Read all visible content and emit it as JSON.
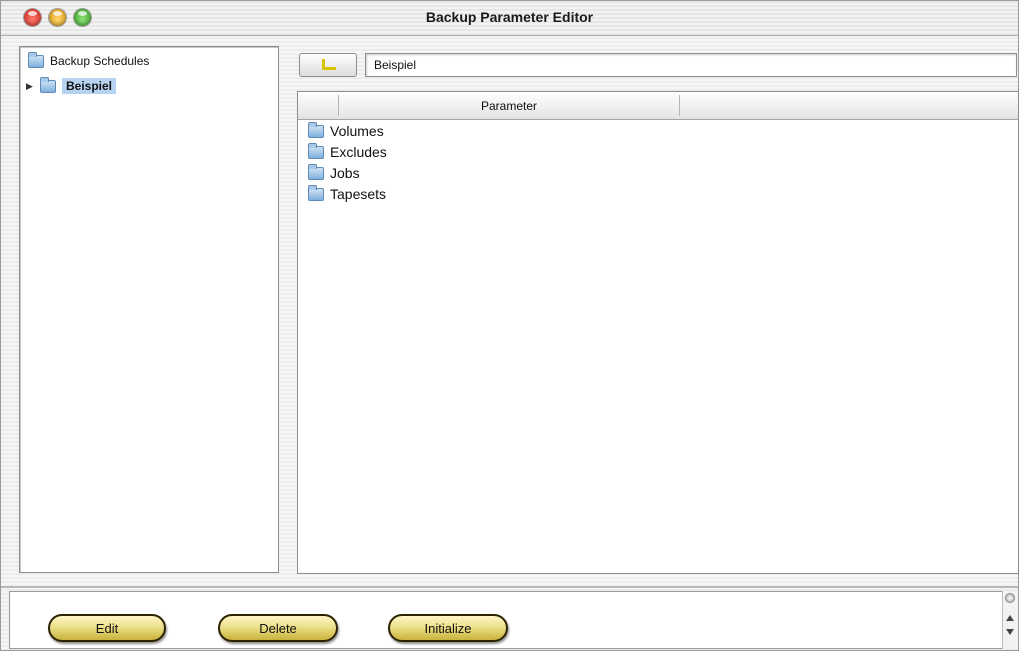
{
  "window": {
    "title": "Backup Parameter Editor"
  },
  "tree": {
    "root_label": "Backup Schedules",
    "children": [
      {
        "label": "Beispiel",
        "selected": true,
        "icon": "folder-icon"
      }
    ]
  },
  "path": {
    "value": "Beispiel"
  },
  "table": {
    "column_header": "Parameter",
    "rows": [
      {
        "label": "Volumes",
        "icon": "folder-icon"
      },
      {
        "label": "Excludes",
        "icon": "folder-icon"
      },
      {
        "label": "Jobs",
        "icon": "folder-icon"
      },
      {
        "label": "Tapesets",
        "icon": "folder-icon"
      }
    ]
  },
  "buttons": {
    "edit": "Edit",
    "delete": "Delete",
    "initialize": "Initialize"
  },
  "colors": {
    "selection": "#b6d3f2",
    "button_yellow": "#ece08a",
    "up_icon": "#d8c400"
  }
}
